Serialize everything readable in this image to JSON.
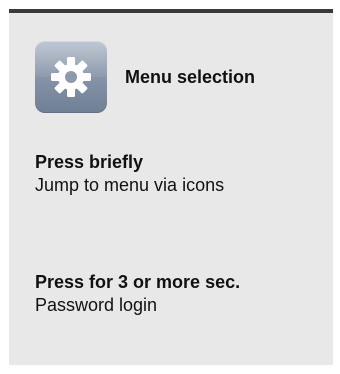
{
  "menu": {
    "icon": "gear-icon",
    "title": "Menu selection"
  },
  "press_briefly": {
    "title": "Press briefly",
    "description": "Jump to menu via icons"
  },
  "press_long": {
    "title": "Press for 3 or more sec.",
    "description": "Password login"
  },
  "colors": {
    "panel_background": "#e8e8e8",
    "top_border": "#3a3a3a",
    "icon_background": "#8392a6",
    "text": "#111111"
  }
}
